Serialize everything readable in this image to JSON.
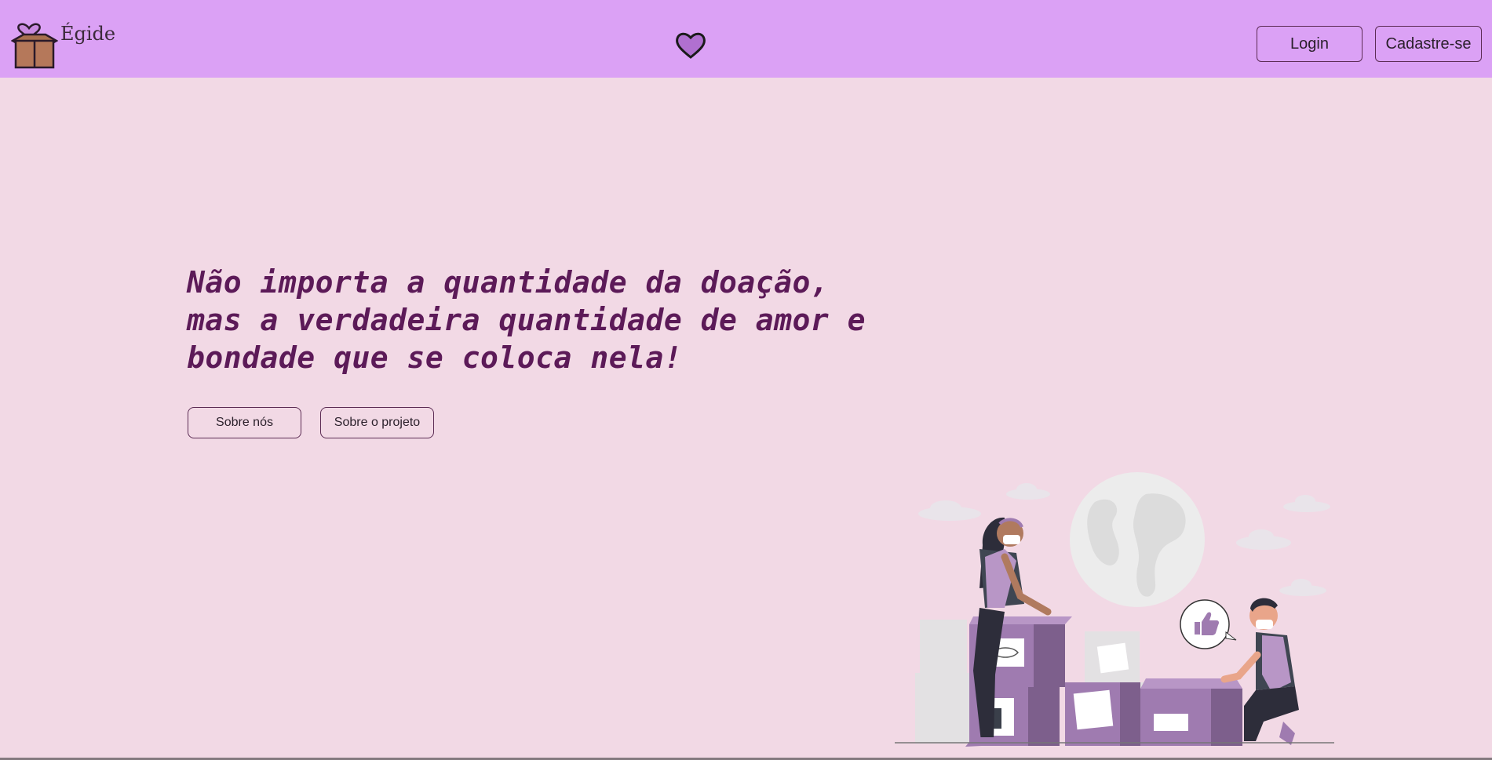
{
  "brand": {
    "name": "Égide",
    "logo_icon": "box-with-heart-icon"
  },
  "header": {
    "center_icon": "heart-icon"
  },
  "nav": {
    "login_label": "Login",
    "signup_label": "Cadastre-se"
  },
  "hero": {
    "quote_lines": [
      "Não importa a quantidade da doação,",
      "mas a verdadeira quantidade de amor e",
      "bondade que se coloca nela!"
    ],
    "about_label": "Sobre nós",
    "project_label": "Sobre o projeto"
  },
  "illustration": {
    "name": "volunteers-packing-donation-boxes"
  },
  "colors": {
    "navbar": "#dba1f5",
    "background": "#f2d9e5",
    "quote_text": "#5c1a58",
    "accent_purple": "#9f7bb0"
  }
}
